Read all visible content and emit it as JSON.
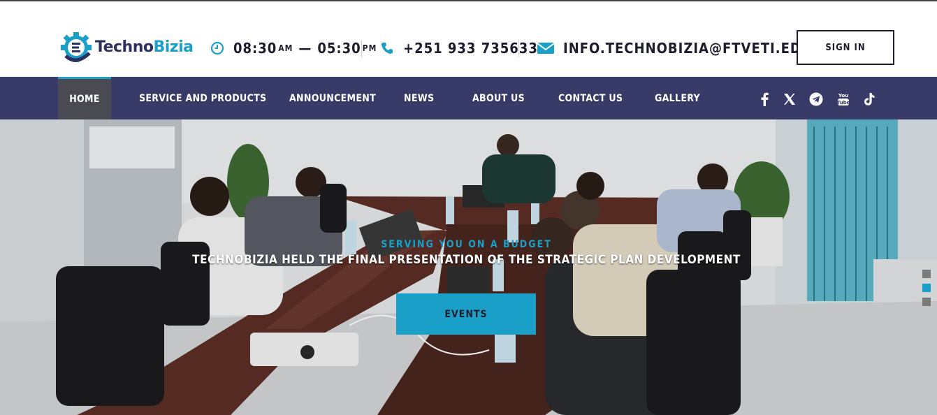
{
  "header": {
    "logo": {
      "part1": "Techno",
      "part2": "Bizia"
    },
    "hours": {
      "open": "08:30",
      "open_suffix": "AM",
      "dash": "—",
      "close": "05:30",
      "close_suffix": "PM"
    },
    "phone": "+251 933 735633",
    "email": "INFO.TECHNOBIZIA@FTVETI.EDU.ET",
    "signin_label": "SIGN IN"
  },
  "nav": {
    "items": [
      {
        "label": "HOME"
      },
      {
        "label": "SERVICE AND PRODUCTS"
      },
      {
        "label": "ANNOUNCEMENT"
      },
      {
        "label": "NEWS"
      },
      {
        "label": "ABOUT US"
      },
      {
        "label": "CONTACT US"
      },
      {
        "label": "GALLERY"
      }
    ],
    "active": "HOME",
    "social": [
      "facebook-icon",
      "x-icon",
      "telegram-icon",
      "youtube-icon",
      "tiktok-icon"
    ]
  },
  "hero": {
    "kicker": "SERVING YOU ON A BUDGET",
    "headline": "TECHNOBIZIA HELD THE FINAL PRESENTATION OF THE STRATEGIC PLAN DEVELOPMENT",
    "button_label": "EVENTS",
    "slides_total": 3,
    "slide_active": 2
  },
  "colors": {
    "accent": "#1aa0c8",
    "nav_bg": "#383a68",
    "text_dark": "#1d1d2b"
  }
}
